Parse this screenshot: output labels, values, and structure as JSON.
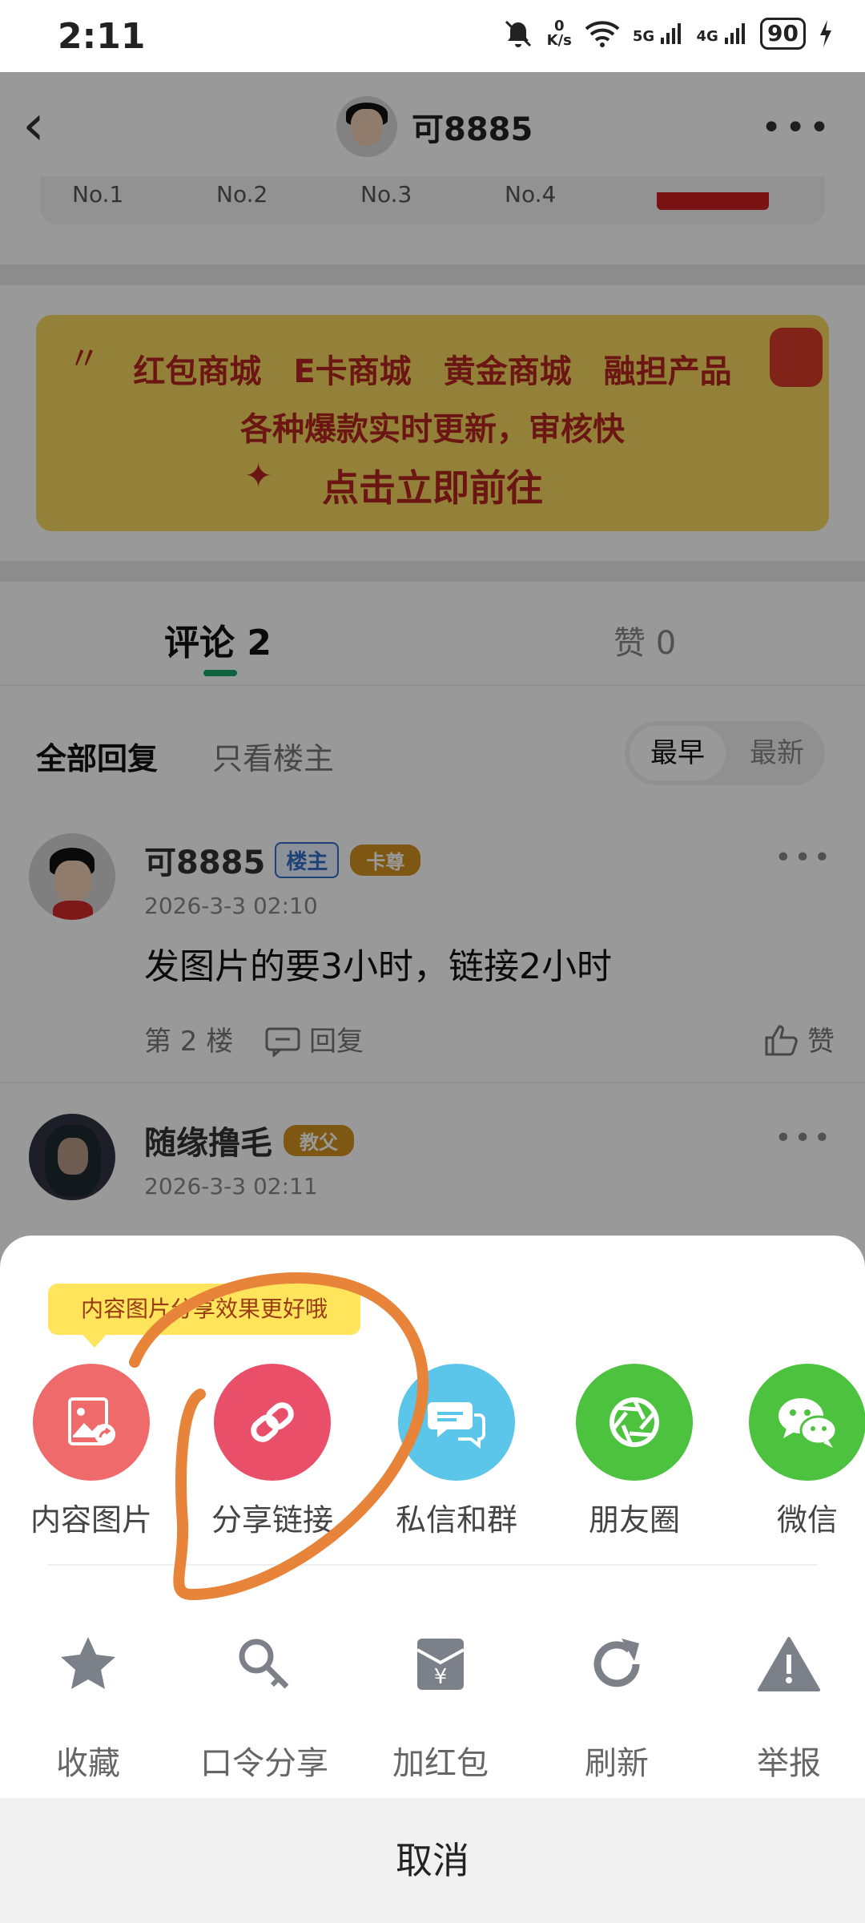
{
  "status": {
    "time": "2:11",
    "net_speed_value": "0",
    "net_speed_unit": "K/s",
    "sig1": "5G",
    "sig2": "4G",
    "battery": "90"
  },
  "header": {
    "title": "可8885"
  },
  "rank_strip": [
    "No.1",
    "No.2",
    "No.3",
    "No.4"
  ],
  "banner": {
    "items": [
      "红包商城",
      "E卡商城",
      "黄金商城",
      "融担产品"
    ],
    "subtitle": "各种爆款实时更新，审核快",
    "cta": "点击立即前往"
  },
  "tabs": {
    "comments": "评论 2",
    "likes": "赞 0"
  },
  "filter": {
    "all": "全部回复",
    "owner_only": "只看楼主",
    "sort_earliest": "最早",
    "sort_latest": "最新"
  },
  "comments": [
    {
      "name": "可8885",
      "owner_badge": "楼主",
      "level_badge": "卡尊",
      "time": "2026-3-3 02:10",
      "text": "发图片的要3小时，链接2小时",
      "floor": "第 2 楼",
      "reply": "回复",
      "like": "赞"
    },
    {
      "name": "随缘撸毛",
      "level_badge": "教父",
      "time": "2026-3-3 02:11"
    }
  ],
  "share_sheet": {
    "tooltip": "内容图片分享效果更好哦",
    "share_items": [
      {
        "label": "内容图片",
        "icon": "image-share-icon",
        "color": "#ef6a6a"
      },
      {
        "label": "分享链接",
        "icon": "link-icon",
        "color": "#ea4f6a"
      },
      {
        "label": "私信和群",
        "icon": "chat-bubbles-icon",
        "color": "#5cc5ea"
      },
      {
        "label": "朋友圈",
        "icon": "aperture-icon",
        "color": "#4cc23f"
      },
      {
        "label": "微信",
        "icon": "wechat-icon",
        "color": "#4cc23f"
      }
    ],
    "tools": [
      {
        "label": "收藏",
        "icon": "star-icon"
      },
      {
        "label": "口令分享",
        "icon": "key-icon"
      },
      {
        "label": "加红包",
        "icon": "red-envelope-icon"
      },
      {
        "label": "刷新",
        "icon": "refresh-icon"
      },
      {
        "label": "举报",
        "icon": "warning-icon"
      }
    ],
    "cancel": "取消"
  },
  "colors": {
    "accent_green": "#19a36c",
    "annotation_orange": "#e8833a",
    "tooltip_yellow": "#ffe45c",
    "icon_gray": "#7b8089"
  }
}
